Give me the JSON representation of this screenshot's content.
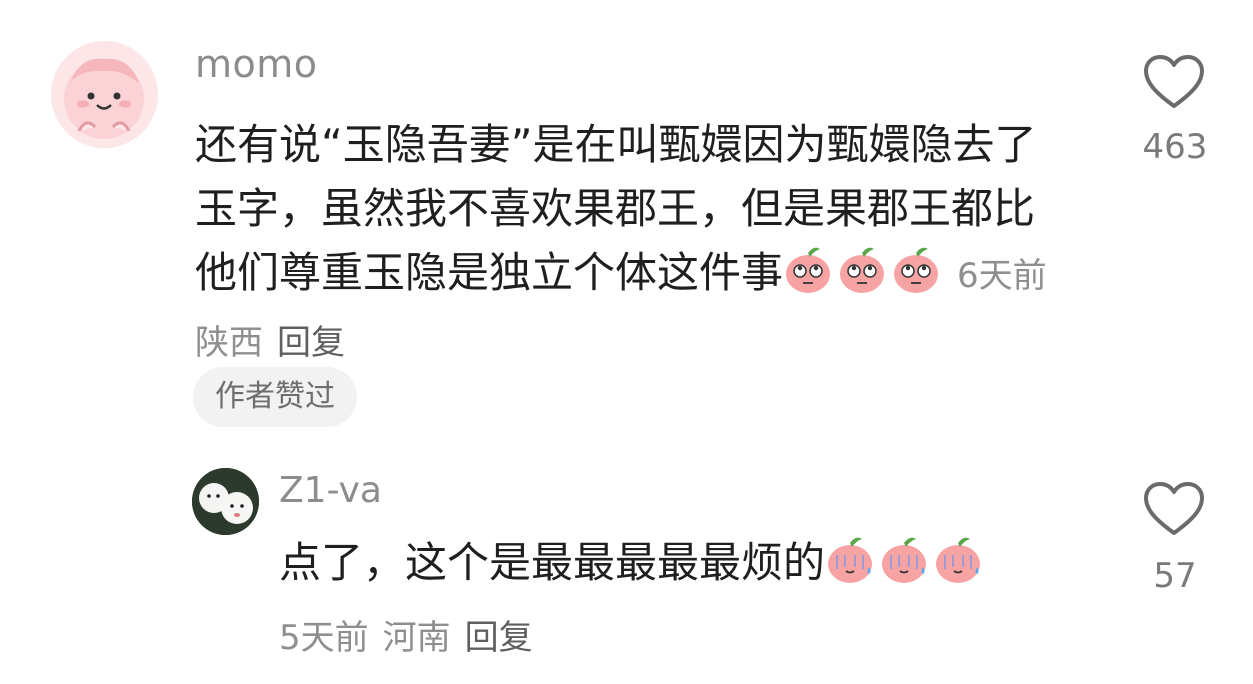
{
  "comment": {
    "username": "momo",
    "text": "还有说“玉隐吾妻”是在叫甄嬛因为甄嬛隐去了玉字，虽然我不喜欢果郡王，但是果郡王都比他们尊重玉隐是独立个体这件事",
    "emojis": [
      "peach-eyeroll-emoji",
      "peach-eyeroll-emoji",
      "peach-eyeroll-emoji"
    ],
    "time": "6天前",
    "location": "陕西",
    "reply_label": "回复",
    "badge": "作者赞过",
    "likes": "463"
  },
  "reply": {
    "username": "Z1-va",
    "text": "点了，这个是最最最最最烦的",
    "emojis": [
      "peach-sweat-emoji",
      "peach-sweat-emoji",
      "peach-sweat-emoji"
    ],
    "time": "5天前",
    "location": "河南",
    "reply_label": "回复",
    "likes": "57"
  },
  "colors": {
    "text": "#1f1f1f",
    "meta": "#8f8f8f",
    "badge_bg": "#f2f2f2"
  }
}
